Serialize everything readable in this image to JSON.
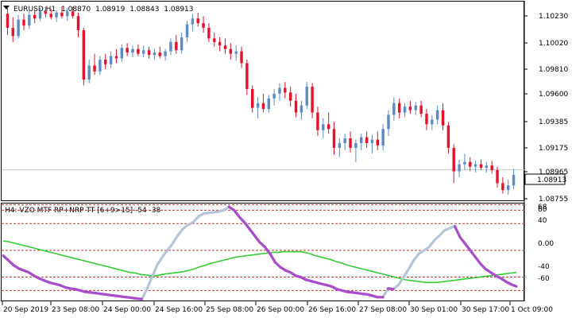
{
  "price_panel": {
    "symbol": "EURUSD",
    "timeframe": "H1",
    "ohlc": {
      "open": "1.08870",
      "high": "1.08919",
      "low": "1.08843",
      "close": "1.08913"
    },
    "current_price_label": "1.08913",
    "scale_labels": [
      "1.10230",
      "1.10020",
      "1.09810",
      "1.09600",
      "1.09385",
      "1.09175",
      "1.08965",
      "1.08755"
    ]
  },
  "indicator_panel": {
    "title": "H4: VZO MTF RP+NRP TT [6+9>15] -54 -38",
    "scale_labels": [
      "68",
      "60",
      "40",
      "0.00",
      "-40",
      "-60"
    ],
    "colors": {
      "vzo_line": "#b4c4dc",
      "vzo_highlight": "#a94dcc",
      "signal_line": "#33cc33",
      "level_lines": "#c0392b"
    }
  },
  "time_axis": {
    "labels": [
      "20 Sep 2019",
      "23 Sep 08:00",
      "24 Sep 00:00",
      "24 Sep 16:00",
      "25 Sep 08:00",
      "26 Sep 00:00",
      "26 Sep 16:00",
      "27 Sep 08:00",
      "30 Sep 01:00",
      "30 Sep 17:00",
      "1 Oct 09:00"
    ]
  },
  "chart_data": {
    "type": "candlestick",
    "colors": {
      "bull": "#5b8bc9",
      "bear": "#e8112d"
    },
    "ylim": [
      1.0866,
      1.1033
    ],
    "series": [
      {
        "o": 1.1024,
        "h": 1.103,
        "l": 1.1006,
        "c": 1.1012
      },
      {
        "o": 1.1012,
        "h": 1.1021,
        "l": 1.1,
        "c": 1.1005
      },
      {
        "o": 1.1005,
        "h": 1.1023,
        "l": 1.1003,
        "c": 1.1019
      },
      {
        "o": 1.1019,
        "h": 1.1024,
        "l": 1.101,
        "c": 1.1014
      },
      {
        "o": 1.1014,
        "h": 1.1027,
        "l": 1.1011,
        "c": 1.1023
      },
      {
        "o": 1.1023,
        "h": 1.1028,
        "l": 1.1016,
        "c": 1.102
      },
      {
        "o": 1.102,
        "h": 1.1029,
        "l": 1.1018,
        "c": 1.1026
      },
      {
        "o": 1.1026,
        "h": 1.103,
        "l": 1.1021,
        "c": 1.1024
      },
      {
        "o": 1.1024,
        "h": 1.1028,
        "l": 1.1019,
        "c": 1.1021
      },
      {
        "o": 1.1021,
        "h": 1.1027,
        "l": 1.1017,
        "c": 1.1025
      },
      {
        "o": 1.1025,
        "h": 1.103,
        "l": 1.102,
        "c": 1.1022
      },
      {
        "o": 1.1022,
        "h": 1.1029,
        "l": 1.1018,
        "c": 1.1026
      },
      {
        "o": 1.1026,
        "h": 1.103,
        "l": 1.102,
        "c": 1.1022
      },
      {
        "o": 1.1022,
        "h": 1.1025,
        "l": 1.1004,
        "c": 1.101
      },
      {
        "o": 1.101,
        "h": 1.1012,
        "l": 1.0963,
        "c": 1.0968
      },
      {
        "o": 1.0968,
        "h": 1.0985,
        "l": 1.0965,
        "c": 1.098
      },
      {
        "o": 1.098,
        "h": 1.099,
        "l": 1.0972,
        "c": 1.0975
      },
      {
        "o": 1.0975,
        "h": 1.0988,
        "l": 1.0972,
        "c": 1.0985
      },
      {
        "o": 1.0985,
        "h": 1.099,
        "l": 1.0977,
        "c": 1.0981
      },
      {
        "o": 1.0981,
        "h": 1.0992,
        "l": 1.0978,
        "c": 1.0988
      },
      {
        "o": 1.0988,
        "h": 1.0994,
        "l": 1.0982,
        "c": 1.0986
      },
      {
        "o": 1.0986,
        "h": 1.0998,
        "l": 1.0983,
        "c": 1.0995
      },
      {
        "o": 1.0995,
        "h": 1.0999,
        "l": 1.0988,
        "c": 1.0991
      },
      {
        "o": 1.0991,
        "h": 1.0997,
        "l": 1.0987,
        "c": 1.0994
      },
      {
        "o": 1.0994,
        "h": 1.0998,
        "l": 1.0988,
        "c": 1.099
      },
      {
        "o": 1.099,
        "h": 1.0997,
        "l": 1.0987,
        "c": 1.0993
      },
      {
        "o": 1.0993,
        "h": 1.0996,
        "l": 1.0986,
        "c": 1.0989
      },
      {
        "o": 1.0989,
        "h": 1.0994,
        "l": 1.0985,
        "c": 1.0991
      },
      {
        "o": 1.0991,
        "h": 1.0996,
        "l": 1.0986,
        "c": 1.0988
      },
      {
        "o": 1.0988,
        "h": 1.0994,
        "l": 1.0984,
        "c": 1.0992
      },
      {
        "o": 1.0992,
        "h": 1.1003,
        "l": 1.0989,
        "c": 1.1
      },
      {
        "o": 1.1,
        "h": 1.1006,
        "l": 1.099,
        "c": 1.0993
      },
      {
        "o": 1.0993,
        "h": 1.1008,
        "l": 1.099,
        "c": 1.1004
      },
      {
        "o": 1.1004,
        "h": 1.1018,
        "l": 1.1,
        "c": 1.1015
      },
      {
        "o": 1.1015,
        "h": 1.1024,
        "l": 1.1009,
        "c": 1.102
      },
      {
        "o": 1.102,
        "h": 1.1025,
        "l": 1.1013,
        "c": 1.1016
      },
      {
        "o": 1.1016,
        "h": 1.1022,
        "l": 1.1008,
        "c": 1.1012
      },
      {
        "o": 1.1012,
        "h": 1.1016,
        "l": 1.1,
        "c": 1.1003
      },
      {
        "o": 1.1003,
        "h": 1.1008,
        "l": 1.0996,
        "c": 1.1
      },
      {
        "o": 1.1,
        "h": 1.1004,
        "l": 1.0992,
        "c": 1.0997
      },
      {
        "o": 1.0997,
        "h": 1.1003,
        "l": 1.099,
        "c": 1.0994
      },
      {
        "o": 1.0994,
        "h": 1.0999,
        "l": 1.0985,
        "c": 1.099
      },
      {
        "o": 1.099,
        "h": 1.0997,
        "l": 1.0984,
        "c": 1.0992
      },
      {
        "o": 1.0992,
        "h": 1.0996,
        "l": 1.0978,
        "c": 1.0982
      },
      {
        "o": 1.0982,
        "h": 1.0985,
        "l": 1.0955,
        "c": 1.096
      },
      {
        "o": 1.096,
        "h": 1.0963,
        "l": 1.094,
        "c": 1.0944
      },
      {
        "o": 1.0944,
        "h": 1.0953,
        "l": 1.0935,
        "c": 1.0948
      },
      {
        "o": 1.0948,
        "h": 1.0956,
        "l": 1.094,
        "c": 1.0943
      },
      {
        "o": 1.0943,
        "h": 1.0955,
        "l": 1.094,
        "c": 1.0952
      },
      {
        "o": 1.0952,
        "h": 1.096,
        "l": 1.0946,
        "c": 1.0956
      },
      {
        "o": 1.0956,
        "h": 1.0965,
        "l": 1.095,
        "c": 1.0961
      },
      {
        "o": 1.0961,
        "h": 1.0966,
        "l": 1.0952,
        "c": 1.0957
      },
      {
        "o": 1.0957,
        "h": 1.0962,
        "l": 1.0945,
        "c": 1.095
      },
      {
        "o": 1.095,
        "h": 1.0956,
        "l": 1.0936,
        "c": 1.094
      },
      {
        "o": 1.094,
        "h": 1.095,
        "l": 1.0934,
        "c": 1.0946
      },
      {
        "o": 1.0946,
        "h": 1.0966,
        "l": 1.0943,
        "c": 1.0962
      },
      {
        "o": 1.0962,
        "h": 1.0965,
        "l": 1.0935,
        "c": 1.094
      },
      {
        "o": 1.094,
        "h": 1.0945,
        "l": 1.092,
        "c": 1.0925
      },
      {
        "o": 1.0925,
        "h": 1.0935,
        "l": 1.0918,
        "c": 1.093
      },
      {
        "o": 1.093,
        "h": 1.094,
        "l": 1.0922,
        "c": 1.0926
      },
      {
        "o": 1.0926,
        "h": 1.0932,
        "l": 1.0904,
        "c": 1.091
      },
      {
        "o": 1.091,
        "h": 1.0918,
        "l": 1.0902,
        "c": 1.0914
      },
      {
        "o": 1.0914,
        "h": 1.0922,
        "l": 1.0908,
        "c": 1.0918
      },
      {
        "o": 1.0918,
        "h": 1.0924,
        "l": 1.0906,
        "c": 1.091
      },
      {
        "o": 1.091,
        "h": 1.0917,
        "l": 1.0898,
        "c": 1.0914
      },
      {
        "o": 1.0914,
        "h": 1.0922,
        "l": 1.0908,
        "c": 1.0919
      },
      {
        "o": 1.0919,
        "h": 1.0924,
        "l": 1.091,
        "c": 1.0914
      },
      {
        "o": 1.0914,
        "h": 1.0921,
        "l": 1.0905,
        "c": 1.0917
      },
      {
        "o": 1.0917,
        "h": 1.0924,
        "l": 1.0908,
        "c": 1.0912
      },
      {
        "o": 1.0912,
        "h": 1.093,
        "l": 1.0908,
        "c": 1.0926
      },
      {
        "o": 1.0926,
        "h": 1.0942,
        "l": 1.092,
        "c": 1.0938
      },
      {
        "o": 1.0938,
        "h": 1.0953,
        "l": 1.0933,
        "c": 1.0948
      },
      {
        "o": 1.0948,
        "h": 1.0952,
        "l": 1.0935,
        "c": 1.094
      },
      {
        "o": 1.094,
        "h": 1.0948,
        "l": 1.0936,
        "c": 1.0945
      },
      {
        "o": 1.0945,
        "h": 1.095,
        "l": 1.0939,
        "c": 1.0942
      },
      {
        "o": 1.0942,
        "h": 1.0949,
        "l": 1.0938,
        "c": 1.0946
      },
      {
        "o": 1.0946,
        "h": 1.095,
        "l": 1.0936,
        "c": 1.0939
      },
      {
        "o": 1.0939,
        "h": 1.0943,
        "l": 1.0925,
        "c": 1.093
      },
      {
        "o": 1.093,
        "h": 1.0938,
        "l": 1.0925,
        "c": 1.0934
      },
      {
        "o": 1.0934,
        "h": 1.0946,
        "l": 1.093,
        "c": 1.0942
      },
      {
        "o": 1.0942,
        "h": 1.0948,
        "l": 1.0925,
        "c": 1.0929
      },
      {
        "o": 1.0929,
        "h": 1.0932,
        "l": 1.0905,
        "c": 1.091
      },
      {
        "o": 1.091,
        "h": 1.0913,
        "l": 1.088,
        "c": 1.089
      },
      {
        "o": 1.089,
        "h": 1.09,
        "l": 1.0885,
        "c": 1.0896
      },
      {
        "o": 1.0896,
        "h": 1.0905,
        "l": 1.0891,
        "c": 1.0898
      },
      {
        "o": 1.0898,
        "h": 1.0902,
        "l": 1.089,
        "c": 1.0894
      },
      {
        "o": 1.0894,
        "h": 1.0899,
        "l": 1.0889,
        "c": 1.0896
      },
      {
        "o": 1.0896,
        "h": 1.09,
        "l": 1.0891,
        "c": 1.0893
      },
      {
        "o": 1.0893,
        "h": 1.0898,
        "l": 1.0889,
        "c": 1.0895
      },
      {
        "o": 1.0895,
        "h": 1.0899,
        "l": 1.0888,
        "c": 1.0891
      },
      {
        "o": 1.0891,
        "h": 1.0894,
        "l": 1.0876,
        "c": 1.088
      },
      {
        "o": 1.088,
        "h": 1.0885,
        "l": 1.0871,
        "c": 1.0874
      },
      {
        "o": 1.0874,
        "h": 1.0883,
        "l": 1.087,
        "c": 1.0878
      },
      {
        "o": 1.0878,
        "h": 1.0892,
        "l": 1.0875,
        "c": 1.0887
      }
    ],
    "indicator": {
      "ylim": [
        -75,
        70
      ],
      "levels": [
        68,
        60,
        40,
        0,
        -40,
        -60
      ],
      "vzo": [
        -8,
        -15,
        -22,
        -27,
        -30,
        -33,
        -38,
        -42,
        -45,
        -48,
        -50,
        -52,
        -55,
        -57,
        -58,
        -60,
        -62,
        -63,
        -64,
        -65,
        -66,
        -67,
        -68,
        -69,
        -70,
        -71,
        -72,
        -73,
        -58,
        -40,
        -22,
        -10,
        0,
        10,
        22,
        32,
        38,
        42,
        50,
        55,
        56,
        57,
        58,
        60,
        65,
        60,
        50,
        42,
        32,
        22,
        12,
        5,
        -5,
        -18,
        -25,
        -30,
        -33,
        -38,
        -40,
        -44,
        -46,
        -48,
        -50,
        -52,
        -54,
        -58,
        -60,
        -62,
        -63,
        -64,
        -65,
        -66,
        -68,
        -70,
        -70,
        -57,
        -58,
        -52,
        -40,
        -28,
        -15,
        -5,
        0,
        5,
        15,
        22,
        30,
        33,
        36,
        20,
        10,
        0,
        -10,
        -20,
        -28,
        -33,
        -38,
        -42,
        -47,
        -51,
        -54
      ],
      "signal": [
        14,
        13,
        11,
        9,
        7,
        5,
        3,
        1,
        -1,
        -3,
        -5,
        -7,
        -9,
        -11,
        -13,
        -15,
        -17,
        -19,
        -21,
        -23,
        -25,
        -27,
        -29,
        -31,
        -33,
        -34,
        -36,
        -37,
        -38,
        -38,
        -36,
        -35,
        -34,
        -33,
        -32,
        -30,
        -28,
        -25,
        -23,
        -20,
        -18,
        -16,
        -14,
        -12,
        -10,
        -9,
        -8,
        -7,
        -6,
        -5,
        -4,
        -3,
        -3,
        -2,
        -2,
        -2,
        -2,
        -3,
        -5,
        -8,
        -10,
        -12,
        -14,
        -17,
        -19,
        -22,
        -24,
        -26,
        -28,
        -30,
        -32,
        -34,
        -36,
        -38,
        -40,
        -42,
        -44,
        -45,
        -46,
        -47,
        -48,
        -48,
        -48,
        -47,
        -46,
        -45,
        -44,
        -43,
        -42,
        -41,
        -40,
        -39,
        -38,
        -37,
        -36,
        -35,
        -34,
        -33
      ]
    }
  }
}
